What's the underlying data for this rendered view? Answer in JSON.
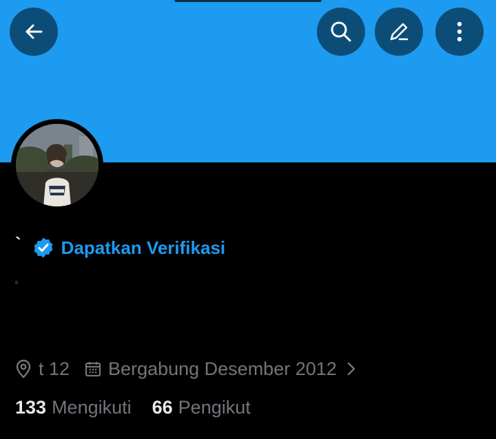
{
  "header": {
    "back_icon": "arrow-left-icon",
    "search_icon": "search-icon",
    "edit_icon": "pencil-icon",
    "more_icon": "more-vertical-icon",
    "banner_color": "#1d9bf0",
    "button_color": "#0c4d78"
  },
  "profile": {
    "display_name": "`",
    "verify_label": "Dapatkan Verifikasi",
    "verify_icon": "verified-badge-icon",
    "accent_color": "#1d9bf0"
  },
  "meta": {
    "location_icon": "location-pin-icon",
    "location": "t 12",
    "joined_icon": "calendar-icon",
    "joined": "Bergabung Desember 2012",
    "chevron_icon": "chevron-right-icon"
  },
  "stats": {
    "following_count": "133",
    "following_label": "Mengikuti",
    "followers_count": "66",
    "followers_label": "Pengikut"
  }
}
